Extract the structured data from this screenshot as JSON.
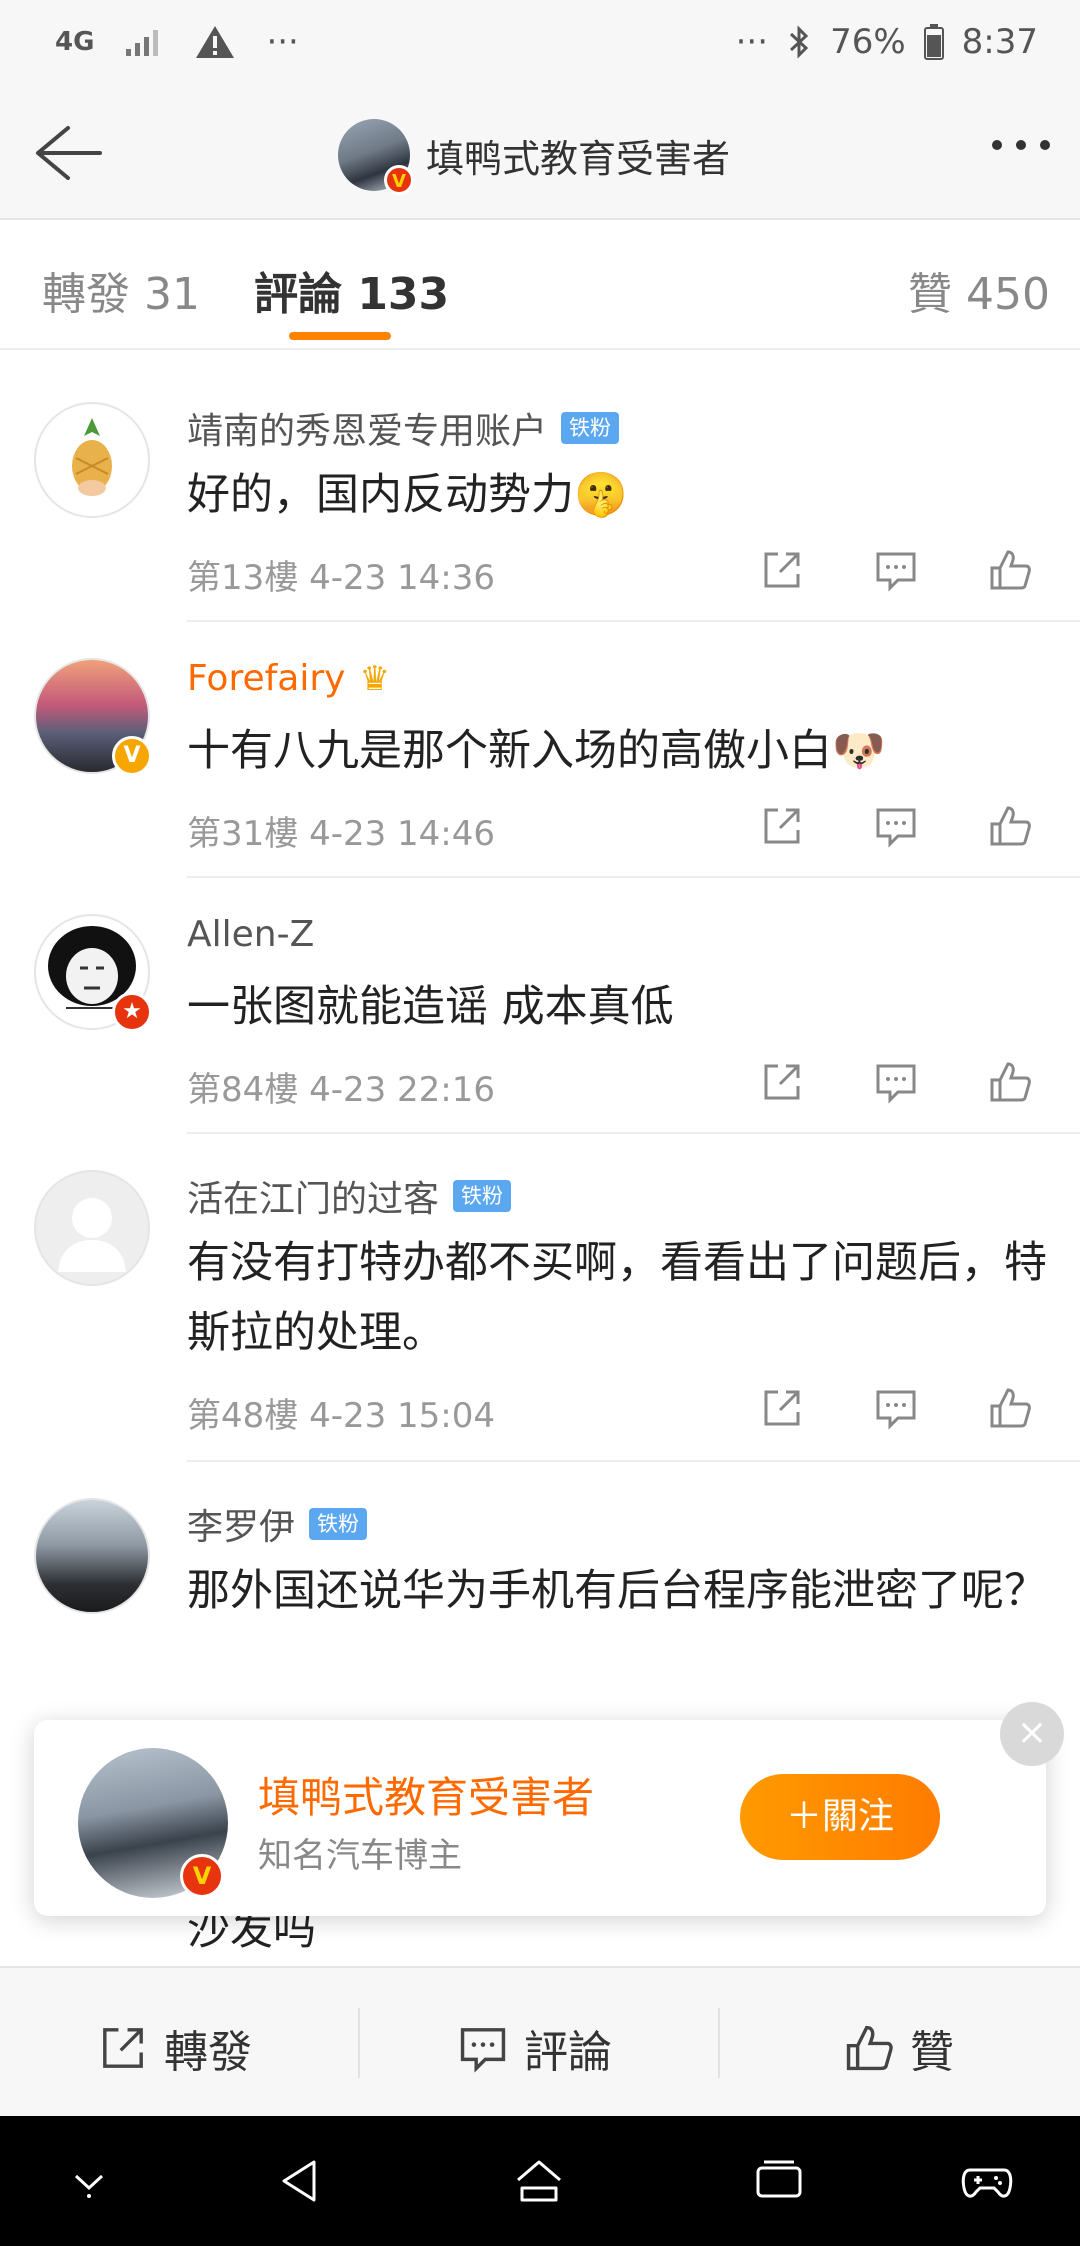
{
  "status_bar": {
    "network": "4G",
    "left_dots": "···",
    "right_dots": "···",
    "battery_percent": "76%",
    "time": "8:37"
  },
  "header": {
    "title": "填鸭式教育受害者",
    "verified_mark": "V"
  },
  "tabs": [
    {
      "label": "轉發 31",
      "active": false
    },
    {
      "label": "評論 133",
      "active": true
    },
    {
      "label": "贊 450",
      "active": false
    }
  ],
  "comments": [
    {
      "name": "靖南的秀恩爱专用账户",
      "badge": "铁粉",
      "text": "好的，国内反动势力🤫",
      "meta": "第13樓 4-23 14:36"
    },
    {
      "name": "Forefairy",
      "badge": "",
      "text": "十有八九是那个新入场的高傲小白🐶",
      "meta": "第31樓 4-23 14:46"
    },
    {
      "name": "Allen-Z",
      "badge": "",
      "text": "一张图就能造谣 成本真低",
      "meta": "第84樓 4-23 22:16"
    },
    {
      "name": "活在江门的过客",
      "badge": "铁粉",
      "text": "有没有打特办都不买啊，看看出了问题后，特斯拉的处理。",
      "meta": "第48樓 4-23 15:04"
    },
    {
      "name": "李罗伊",
      "badge": "铁粉",
      "text": "那外国还说华为手机有后台程序能泄密了呢？",
      "meta": ""
    }
  ],
  "peek_text": "沙发吗",
  "follow_card": {
    "name": "填鸭式教育受害者",
    "description": "知名汽车博主",
    "button": "＋關注",
    "close": "×"
  },
  "bottom_bar": {
    "repost": "轉發",
    "comment": "評論",
    "like": "贊"
  },
  "colors": {
    "accent": "#ff8200",
    "name_highlight": "#ff6a00",
    "fan_badge": "#5ca8f0"
  }
}
